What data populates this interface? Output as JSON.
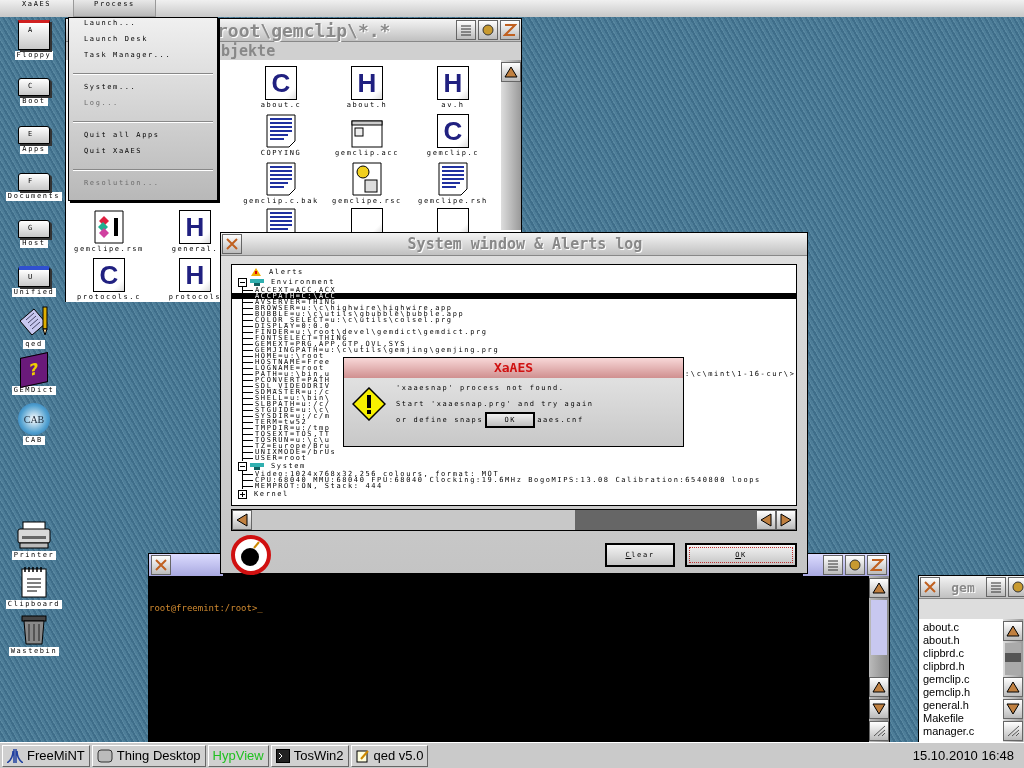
{
  "menubar": {
    "items": [
      {
        "label": "XaAES",
        "selected": false
      },
      {
        "label": "Process",
        "selected": true
      }
    ]
  },
  "menu": {
    "items": [
      {
        "kind": "item",
        "label": "Launch...",
        "disabled": false
      },
      {
        "kind": "item",
        "label": "Launch Desk",
        "disabled": false
      },
      {
        "kind": "item",
        "label": "Task Manager...",
        "disabled": false
      },
      {
        "kind": "separator"
      },
      {
        "kind": "item",
        "label": "System...",
        "disabled": false
      },
      {
        "kind": "item",
        "label": "Log...",
        "disabled": true
      },
      {
        "kind": "separator"
      },
      {
        "kind": "item",
        "label": "Quit all Apps",
        "disabled": false
      },
      {
        "kind": "item",
        "label": "Quit XaAES",
        "disabled": false
      },
      {
        "kind": "separator"
      },
      {
        "kind": "item",
        "label": "Resolution...",
        "disabled": true
      }
    ]
  },
  "desktop": [
    {
      "kind": "floppy",
      "letter": "A",
      "label": "Floppy"
    },
    {
      "kind": "drive",
      "letter": "C",
      "label": "Boot"
    },
    {
      "kind": "drive",
      "letter": "E",
      "label": "Apps"
    },
    {
      "kind": "drive",
      "letter": "F",
      "label": "Documents"
    },
    {
      "kind": "drive",
      "letter": "G",
      "label": "Host"
    },
    {
      "kind": "network",
      "letter": "U",
      "label": "Unified"
    },
    {
      "kind": "editor",
      "label": "qed"
    },
    {
      "kind": "book",
      "glyph": "?",
      "label": "GEMDict"
    },
    {
      "kind": "globe",
      "glyph": "CAB",
      "label": "CAB"
    },
    {
      "kind": "printer",
      "label": "Printer"
    },
    {
      "kind": "clipboard",
      "label": "Clipboard"
    },
    {
      "kind": "trash",
      "label": "Wastebin"
    }
  ],
  "file_window": {
    "title": "root\\gemclip\\*.*",
    "info": "bjekte",
    "items": [
      {
        "kind": "letter",
        "glyph": "C",
        "label": "about.c"
      },
      {
        "kind": "letter",
        "glyph": "H",
        "label": "about.h"
      },
      {
        "kind": "letter",
        "glyph": "H",
        "label": "av.h"
      },
      {
        "kind": "text",
        "label": "COPYING"
      },
      {
        "kind": "app",
        "label": "gemclip.acc"
      },
      {
        "kind": "letter",
        "glyph": "C",
        "label": "gemclip.c"
      },
      {
        "kind": "text",
        "label": "gemclip.c.bak"
      },
      {
        "kind": "rsc",
        "label": "gemclipe.rsc"
      },
      {
        "kind": "text",
        "label": "gemclipe.rsh"
      },
      {
        "kind": "rsm",
        "label": "gemclipe.rsm"
      },
      {
        "kind": "letter",
        "glyph": "H",
        "label": "general."
      },
      {
        "kind": "text"
      },
      {
        "kind": "letter"
      },
      {
        "kind": "letter"
      },
      {
        "kind": "letter",
        "glyph": "C",
        "label": "protocols.c"
      },
      {
        "kind": "letter",
        "glyph": "H",
        "label": "protocols"
      }
    ]
  },
  "system_window": {
    "title": "System window & Alerts log",
    "tree": [
      {
        "kind": "alerts",
        "label": "Alerts"
      },
      {
        "kind": "env",
        "label": "Environment",
        "expanded": true,
        "children": [
          {
            "label": "ACCEXT=ACC,ACX",
            "selected": false
          },
          {
            "label": "ACCPATH=C:\\ACC",
            "selected": true
          },
          {
            "label": "AVSERVER=THING",
            "selected": false
          },
          {
            "label": "BROWSER=u:\\c\\highwire\\highwire.app",
            "selected": false
          },
          {
            "label": "BUBBLE=u:\\c\\utils\\gbubble\\bubble.app",
            "selected": false
          },
          {
            "label": "COLOR_SELECT=u:\\c\\utils\\colsel.prg",
            "selected": false
          },
          {
            "label": "DISPLAY=0:0.0",
            "selected": false
          },
          {
            "label": "FINDER=u:\\root\\devel\\gemdict\\gemdict.prg",
            "selected": false
          },
          {
            "label": "FONTSELECT=THING",
            "selected": false
          },
          {
            "label": "GEMEXT=PRG,APP,GTP,OVL,SYS",
            "selected": false
          },
          {
            "label": "GEMJINGPATH=u:\\c\\utils\\gemjing\\gemjing.prg",
            "selected": false
          },
          {
            "label": "HOME=u:\\root",
            "selected": false
          },
          {
            "label": "HOSTNAME=Free",
            "selected": false
          },
          {
            "label": "LOGNAME=root",
            "selected": false
          },
          {
            "label": "PATH=u:\\bin,u",
            "tail": ":\\c\\mint\\1-16-cur\\>",
            "selected": false
          },
          {
            "label": "PCONVERT=PATH",
            "selected": false
          },
          {
            "label": "SDL_VIDEODRIV",
            "selected": false
          },
          {
            "label": "SDMASTER=u:/c",
            "selected": false
          },
          {
            "label": "SHELL=u:\\bin\\",
            "selected": false
          },
          {
            "label": "SLBPATH=u:/c/",
            "selected": false
          },
          {
            "label": "STGUIDE=u:\\c\\",
            "selected": false
          },
          {
            "label": "SYSDIR=u:/c/m",
            "selected": false
          },
          {
            "label": "TERM=tw52",
            "selected": false
          },
          {
            "label": "TMPDIR=u:/tmp",
            "selected": false
          },
          {
            "label": "TOSEXT=TOS,TT",
            "selected": false
          },
          {
            "label": "TOSRUN=u:\\c\\u",
            "selected": false
          },
          {
            "label": "TZ=Europe/Bru",
            "selected": false
          },
          {
            "label": "UNIXMODE=/brUs",
            "selected": false
          },
          {
            "label": "USER=root",
            "selected": false
          }
        ]
      },
      {
        "kind": "env",
        "label": "System",
        "expanded": true,
        "children": [
          {
            "label": "Video:1024x768x32,256 colours, format: MOT",
            "selected": false
          },
          {
            "label": "CPU:68040 MMU:68040 FPU:68040 Clocking:19.6MHz BogoMIPS:13.08 Calibration:6540800 loops",
            "selected": false
          },
          {
            "label": "MEMPROT:ON, Stack: 444",
            "selected": false
          }
        ]
      },
      {
        "kind": "kernel",
        "label": "Kernel",
        "expanded": false
      }
    ],
    "buttons": [
      {
        "label": "Clear",
        "default": false
      },
      {
        "label": "OK",
        "default": true
      }
    ]
  },
  "alert": {
    "title": "XaAES",
    "lines": [
      "'xaaesnap' process not found.",
      "Start 'xaaesnap.prg' and try again"
    ],
    "last_line_start": "or define snaps",
    "last_line_end": "aaes.cnf",
    "button": "OK"
  },
  "terminal": {
    "prompt": "root@freemint:/root>_"
  },
  "gem_window": {
    "title": "gem",
    "files": [
      "about.c",
      "about.h",
      "clipbrd.c",
      "clipbrd.h",
      "gemclip.c",
      "gemclip.h",
      "general.h",
      "Makefile",
      "manager.c"
    ]
  },
  "taskbar": {
    "items": [
      {
        "kind": "atari",
        "label": "FreeMiNT",
        "hidden": false
      },
      {
        "kind": "thing",
        "label": "Thing Desktop",
        "hidden": false
      },
      {
        "kind": "plain",
        "label": "HypView",
        "hidden": true
      },
      {
        "kind": "terminal",
        "label": "TosWin2",
        "hidden": false
      },
      {
        "kind": "editor",
        "label": "qed v5.0",
        "hidden": false
      }
    ],
    "clock": "15.10.2010 16:48"
  }
}
